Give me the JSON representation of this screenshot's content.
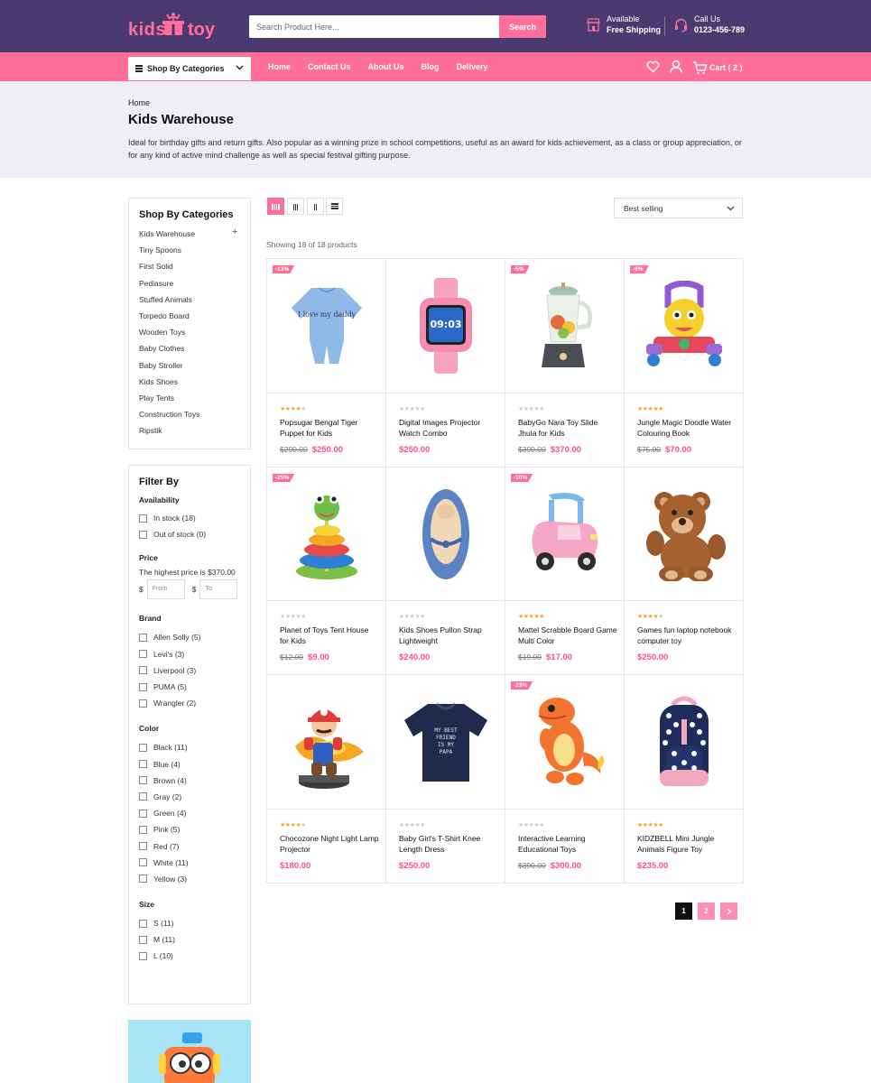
{
  "header": {
    "logo_left": "kids",
    "logo_right": "toy",
    "search_placeholder": "Search Product Here...",
    "search_button": "Search",
    "shipping_line1": "Available",
    "shipping_line2": "Free Shipping",
    "call_line1": "Call Us",
    "call_line2": "0123-456-789"
  },
  "nav": {
    "category_select": "Shop By Categories",
    "links": [
      "Home",
      "Contact Us",
      "About Us",
      "Blog",
      "Delivery"
    ],
    "cart_label": "Cart ( 2 )"
  },
  "banner": {
    "breadcrumb": "Home",
    "title": "Kids Warehouse",
    "description": "Ideal for birthday gifts and return gifts. Also popular as a winning prize in school competitions, useful as an award for kids achievement, as a class or group appreciation, or for any kind of active mind challenge as well as special festival gifting purpose."
  },
  "sidebar": {
    "categories_title": "Shop By Categories",
    "categories": [
      "Kids Warehouse",
      "Tiny Spoons",
      "First Solid",
      "Pediasure",
      "Stuffed Animals",
      "Torpedo Board",
      "Wooden Toys",
      "Baby Clothes",
      "Baby Stroller",
      "Kids Shoes",
      "Play Tents",
      "Construction Toys",
      "Ripstik"
    ],
    "filter_title": "Filter By",
    "availability_title": "Availability",
    "availability": [
      "In stock (18)",
      "Out of stock (0)"
    ],
    "price_title": "Price",
    "price_note": "The highest price is $370.00",
    "currency": "$",
    "from_placeholder": "From",
    "to_placeholder": "To",
    "brand_title": "Brand",
    "brands": [
      "Allen Solly (5)",
      "Levi's (3)",
      "Liverpool (3)",
      "PUMA (5)",
      "Wrangler (2)"
    ],
    "color_title": "Color",
    "colors": [
      "Black (11)",
      "Blue (4)",
      "Brown (4)",
      "Gray (2)",
      "Green (4)",
      "Pink (5)",
      "Red (7)",
      "White (11)",
      "Yellow (3)"
    ],
    "size_title": "Size",
    "sizes": [
      "S (11)",
      "M (11)",
      "L (10)"
    ]
  },
  "toolbar": {
    "sort_value": "Best selling",
    "showing": "Showing 18 of 18 products"
  },
  "products": [
    {
      "name": "Popsugar Bengal Tiger Puppet for Kids",
      "old": "$290.00",
      "price": "$250.00",
      "badge": "-13%",
      "rating": 4,
      "img": "onesie"
    },
    {
      "name": "Digital Images Projector Watch Combo",
      "old": "",
      "price": "$250.00",
      "badge": "",
      "rating": 0,
      "img": "watch"
    },
    {
      "name": "BabyGo Nara Toy Slide Jhula for Kids",
      "old": "$390.00",
      "price": "$370.00",
      "badge": "-5%",
      "rating": 0,
      "img": "blender"
    },
    {
      "name": "Jungle Magic Doodle Water Colouring Book",
      "old": "$75.00",
      "price": "$70.00",
      "badge": "-6%",
      "rating": 5,
      "img": "walker"
    },
    {
      "name": "Planet of Toys Tent House for Kids",
      "old": "$12.00",
      "price": "$9.00",
      "badge": "-25%",
      "rating": 0,
      "img": "stacker"
    },
    {
      "name": "Kids Shoes Pullon Strap Lightweight",
      "old": "",
      "price": "$240.00",
      "badge": "",
      "rating": 0,
      "img": "shoe"
    },
    {
      "name": "Mattel Scrabble Board Game Multi Color",
      "old": "$19.00",
      "price": "$17.00",
      "badge": "-10%",
      "rating": 5,
      "img": "car"
    },
    {
      "name": "Games fun laptop notebook computer toy",
      "old": "",
      "price": "$250.00",
      "badge": "",
      "rating": 4,
      "img": "bear"
    },
    {
      "name": "Chocozone Night Light Lamp Projector",
      "old": "",
      "price": "$180.00",
      "badge": "",
      "rating": 4,
      "img": "mario"
    },
    {
      "name": "Baby Girl's T-Shirt Knee Length Dress",
      "old": "",
      "price": "$250.00",
      "badge": "",
      "rating": 0,
      "img": "tshirt"
    },
    {
      "name": "Interactive Learning Educational Toys",
      "old": "$390.00",
      "price": "$300.00",
      "badge": "-23%",
      "rating": 0,
      "img": "dino"
    },
    {
      "name": "KIDZBELL Mini Jungle Animals Figure Toy",
      "old": "",
      "price": "$235.00",
      "badge": "",
      "rating": 5,
      "img": "backpack"
    }
  ],
  "tshirt_text": "MY BEST FRIEND IS MY PAPA",
  "onesie_text": "I love my daddy",
  "watch_time": "09:03",
  "pagination": [
    "1",
    "2"
  ],
  "colors": {
    "header_bg": "#4a3a70",
    "accent": "#ff6f9a",
    "banner_bg": "#f0edf8"
  }
}
